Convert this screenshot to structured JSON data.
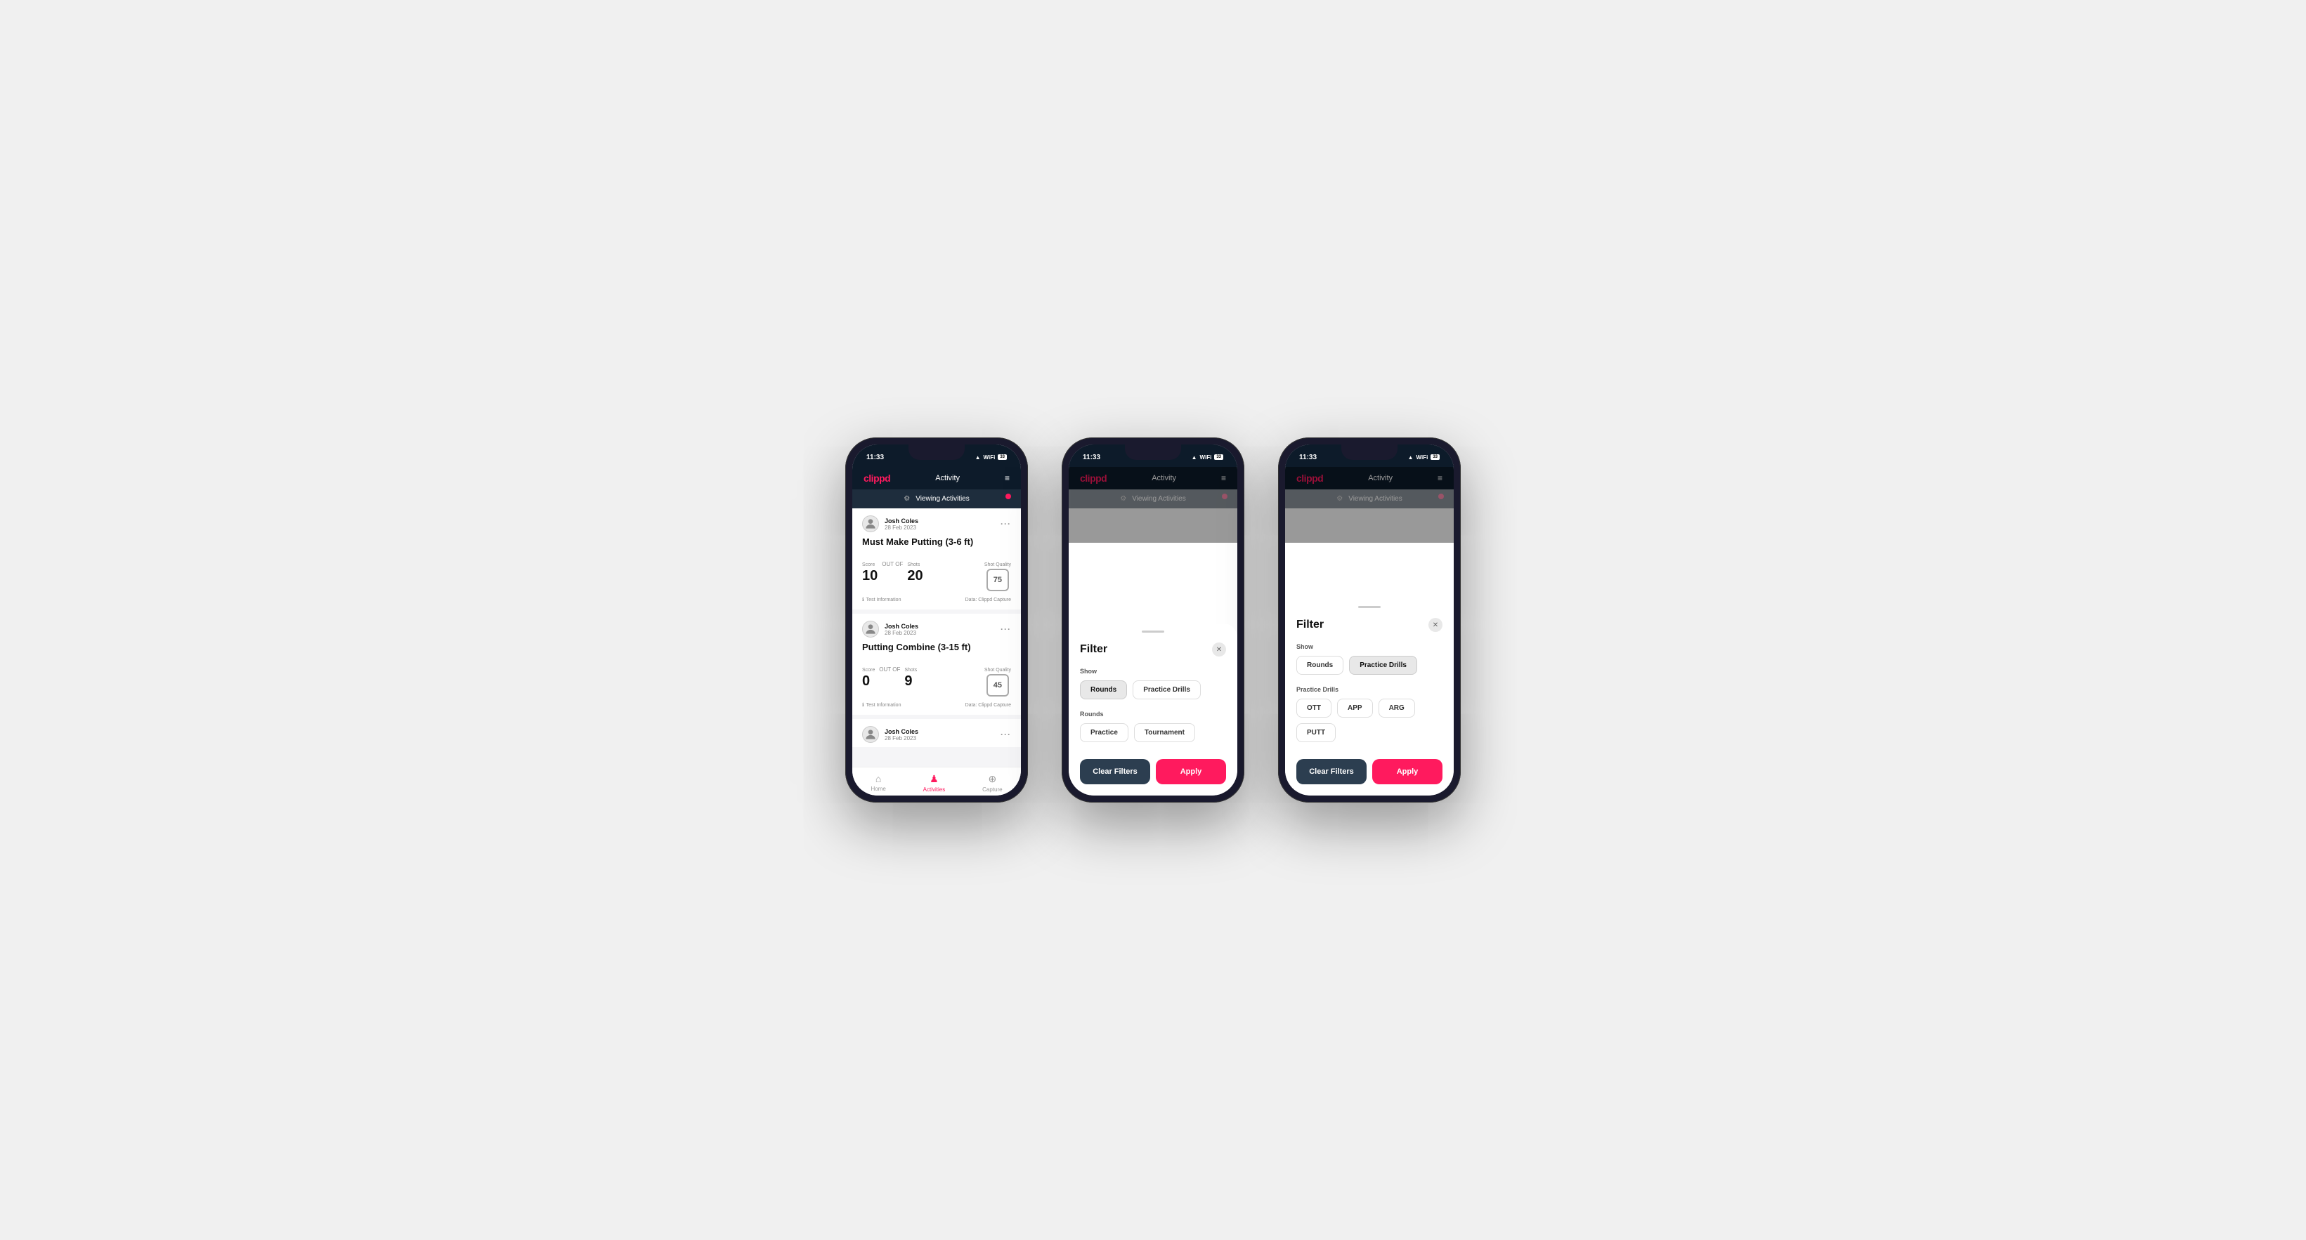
{
  "app": {
    "logo": "clippd",
    "title": "Activity",
    "time": "11:33",
    "status_icons": "▲ ⊕ ⬛"
  },
  "viewing_bar": {
    "label": "Viewing Activities"
  },
  "phone1": {
    "cards": [
      {
        "user": "Josh Coles",
        "date": "28 Feb 2023",
        "title": "Must Make Putting (3-6 ft)",
        "score_label": "Score",
        "score": "10",
        "shots_label": "Shots",
        "shots": "20",
        "sq_label": "Shot Quality",
        "sq": "75",
        "info": "Test Information",
        "data": "Data: Clippd Capture"
      },
      {
        "user": "Josh Coles",
        "date": "28 Feb 2023",
        "title": "Putting Combine (3-15 ft)",
        "score_label": "Score",
        "score": "0",
        "shots_label": "Shots",
        "shots": "9",
        "sq_label": "Shot Quality",
        "sq": "45",
        "info": "Test Information",
        "data": "Data: Clippd Capture"
      }
    ],
    "nav": [
      {
        "label": "Home",
        "active": false
      },
      {
        "label": "Activities",
        "active": true
      },
      {
        "label": "Capture",
        "active": false
      }
    ]
  },
  "phone2": {
    "filter": {
      "title": "Filter",
      "show_label": "Show",
      "show_options": [
        {
          "label": "Rounds",
          "active": true
        },
        {
          "label": "Practice Drills",
          "active": false
        }
      ],
      "rounds_label": "Rounds",
      "rounds_options": [
        {
          "label": "Practice",
          "active": false
        },
        {
          "label": "Tournament",
          "active": false
        }
      ],
      "clear_label": "Clear Filters",
      "apply_label": "Apply"
    }
  },
  "phone3": {
    "filter": {
      "title": "Filter",
      "show_label": "Show",
      "show_options": [
        {
          "label": "Rounds",
          "active": false
        },
        {
          "label": "Practice Drills",
          "active": true
        }
      ],
      "drills_label": "Practice Drills",
      "drills_options": [
        {
          "label": "OTT",
          "active": false
        },
        {
          "label": "APP",
          "active": false
        },
        {
          "label": "ARG",
          "active": false
        },
        {
          "label": "PUTT",
          "active": false
        }
      ],
      "clear_label": "Clear Filters",
      "apply_label": "Apply"
    }
  }
}
